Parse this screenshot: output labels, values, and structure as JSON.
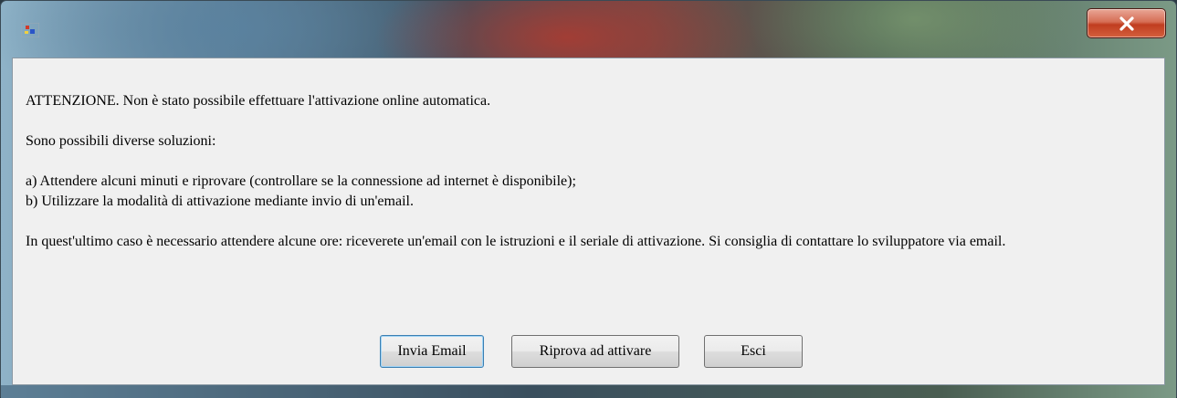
{
  "window": {
    "title": "",
    "close_icon": "close-x-icon",
    "app_icon": "application-icon"
  },
  "message": {
    "line1": "ATTENZIONE. Non è stato possibile effettuare l'attivazione online automatica.",
    "line2": "Sono possibili diverse soluzioni:",
    "line3": "a) Attendere alcuni minuti e riprovare (controllare se la connessione ad internet è disponibile);",
    "line4": "b) Utilizzare la modalità di attivazione mediante invio di un'email.",
    "line5": "In quest'ultimo caso è necessario attendere alcune ore: riceverete un'email con le istruzioni e il seriale di attivazione. Si consiglia di contattare lo sviluppatore via email."
  },
  "buttons": {
    "send_email": "Invia Email",
    "retry": "Riprova ad attivare",
    "exit": "Esci"
  }
}
